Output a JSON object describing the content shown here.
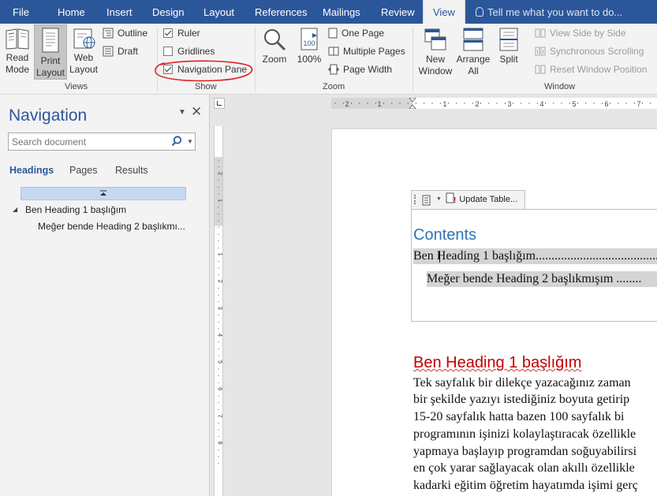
{
  "tabs": [
    {
      "label": "File"
    },
    {
      "label": "Home"
    },
    {
      "label": "Insert"
    },
    {
      "label": "Design"
    },
    {
      "label": "Layout"
    },
    {
      "label": "References"
    },
    {
      "label": "Mailings"
    },
    {
      "label": "Review"
    },
    {
      "label": "View",
      "active": true
    }
  ],
  "tellme": "Tell me what you want to do...",
  "ribbon": {
    "views": {
      "label": "Views",
      "read_mode": "Read Mode",
      "read_mode_l1": "Read",
      "read_mode_l2": "Mode",
      "print_layout_l1": "Print",
      "print_layout_l2": "Layout",
      "web_layout_l1": "Web",
      "web_layout_l2": "Layout",
      "outline": "Outline",
      "draft": "Draft"
    },
    "show": {
      "label": "Show",
      "ruler": "Ruler",
      "ruler_checked": true,
      "gridlines": "Gridlines",
      "gridlines_checked": false,
      "navigation_pane": "Navigation Pane",
      "navigation_pane_checked": true
    },
    "zoom": {
      "label": "Zoom",
      "zoom": "Zoom",
      "hundred": "100%",
      "one_page": "One Page",
      "multiple_pages": "Multiple Pages",
      "page_width": "Page Width"
    },
    "window": {
      "label": "Window",
      "new_window_l1": "New",
      "new_window_l2": "Window",
      "arrange_all_l1": "Arrange",
      "arrange_all_l2": "All",
      "split": "Split",
      "view_side_by_side": "View Side by Side",
      "synchronous_scrolling": "Synchronous Scrolling",
      "reset_window_position": "Reset Window Position"
    }
  },
  "navigation": {
    "title": "Navigation",
    "search_placeholder": "Search document",
    "tabs": [
      "Headings",
      "Pages",
      "Results"
    ],
    "headings": [
      {
        "level": 1,
        "text": "Ben Heading 1 başlığım"
      },
      {
        "level": 2,
        "text": "Meğer bende Heading 2 başlıkmı..."
      }
    ]
  },
  "document": {
    "toc_toolbar": {
      "update_table": "Update Table..."
    },
    "toc_title": "Contents",
    "toc_entries": [
      {
        "text": "Ben Heading 1 başlığım.........................................."
      },
      {
        "text": "Meğer bende Heading 2 başlıkmışım ........"
      }
    ],
    "heading1": "Ben Heading 1 başlığım",
    "body_lines": [
      "Tek sayfalık bir dilekçe yazacağınız zaman",
      "bir şekilde yazıyı istediğiniz boyuta getirip",
      "15-20 sayfalık hatta bazen 100 sayfalık bi",
      "programının işinizi kolaylaştıracak özellikle",
      "yapmaya başlayıp programdan soğuyabilirsi",
      "en çok yarar sağlayacak olan akıllı özellikle",
      "kadarki eğitim öğretim hayatımda işimi gerç"
    ],
    "ruler_h_labels": [
      "2",
      "1",
      "1",
      "2",
      "3",
      "4",
      "5",
      "6",
      "7"
    ],
    "ruler_v_labels": [
      "2",
      "1",
      "1",
      "2",
      "3",
      "4",
      "5",
      "6",
      "7",
      "8",
      "9",
      "10"
    ]
  },
  "colors": {
    "accent": "#2b579a",
    "heading_red": "#c00000",
    "toc_blue": "#2e74b5",
    "annotation": "#e02020"
  }
}
